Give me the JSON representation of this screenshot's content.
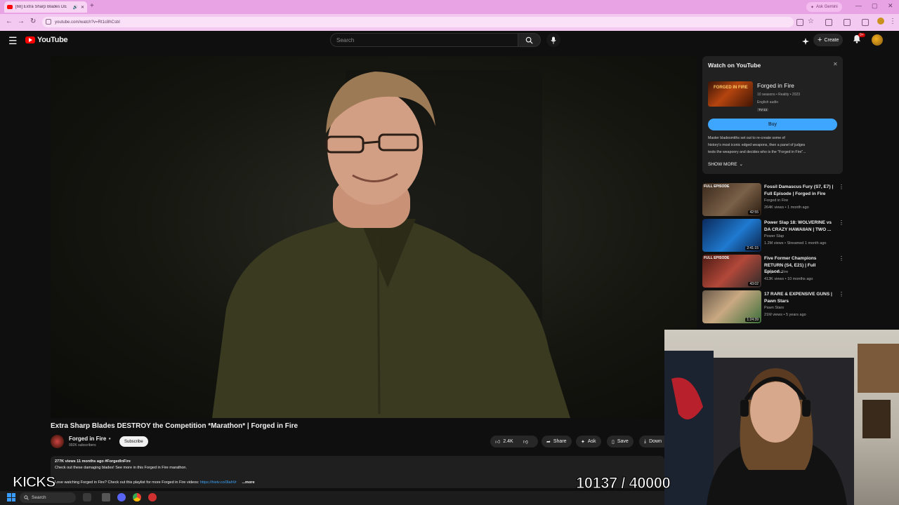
{
  "browser": {
    "tab_title": "[68] Extra Sharp Blades DE",
    "new_tab": "+",
    "ask_gemini": "Ask Gemini",
    "url": "youtube.com/watch?v=Rt1c8hCsbI"
  },
  "header": {
    "logo_text": "YouTube",
    "search_placeholder": "Search",
    "create_label": "Create",
    "notification_count": "9+"
  },
  "video": {
    "title": "Extra Sharp Blades DESTROY the Competition *Marathon* | Forged in Fire",
    "channel": "Forged in Fire",
    "subscribers": "992K subscribers",
    "subscribe_label": "Subscribe",
    "likes": "2.4K",
    "share_label": "Share",
    "ask_label": "Ask",
    "save_label": "Save",
    "download_label": "Down",
    "desc_meta": "277K views  11 months ago  #ForgedInFire",
    "desc_line1": "Check out these damaging blades! See more in this Forged in Fire marathon.",
    "desc_line2_prefix": "Love watching Forged in Fire? Check out this playlist for more Forged in Fire videos:",
    "desc_link": "https://histv.co/3lahVr",
    "more_label": "...more"
  },
  "watch_panel": {
    "title": "Watch on YouTube",
    "show_name": "Forged in Fire",
    "thumb_text": "FORGED IN FIRE",
    "meta1": "10 seasons • Reality • 2023",
    "meta2": "English audio",
    "rating": "TV-14",
    "buy_label": "Buy",
    "desc1": "Master bladesmiths set out to re-create some of",
    "desc2": "history's most iconic edged weapons, then a panel of judges",
    "desc3": "tests the weaponry and decides who is the \"Forged in Fire\"...",
    "show_more": "SHOW MORE"
  },
  "recommendations": [
    {
      "title": "Fossil Damascus Fury (S7, E7) | Full Episode | Forged in Fire",
      "channel": "Forged in Fire",
      "meta": "264K views • 1 month ago",
      "duration": "42:55",
      "badge": "FULL EPISODE"
    },
    {
      "title": "Power Slap 18: WOLVERINE vs DA CRAZY HAWAIIAN | TWO ...",
      "channel": "Power Slap",
      "meta": "1.2M views • Streamed 1 month ago",
      "duration": "2:41:15",
      "badge": ""
    },
    {
      "title": "Five Former Champions RETURN (S4, E21) | Full Episod...",
      "channel": "Forged in Fire",
      "meta": "413K views • 10 months ago",
      "duration": "43:02",
      "badge": "FULL EPISODE"
    },
    {
      "title": "17 RARE & EXPENSIVE GUNS | Pawn Stars",
      "channel": "Pawn Stars",
      "meta": "21M views • 5 years ago",
      "duration": "1:24:39",
      "badge": ""
    }
  ],
  "overlay": {
    "kicks": "KICKS",
    "counter": "10137 / 40000"
  },
  "taskbar": {
    "search_label": "Search"
  }
}
